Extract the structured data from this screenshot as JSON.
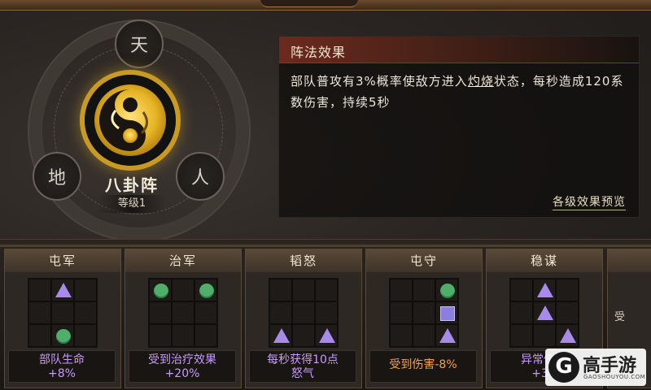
{
  "formation": {
    "name": "八卦阵",
    "level": "等级1",
    "nodes": [
      "天",
      "地",
      "人"
    ]
  },
  "effect": {
    "title": "阵法效果",
    "desc_before": "部队普攻有3%概率使敌方进入",
    "desc_highlight": "灼烧",
    "desc_after": "状态，每秒造成120系数伤害，持续5秒",
    "preview_link": "各级效果预览"
  },
  "cards": [
    {
      "title": "屯军",
      "bonus_line1": "部队生命",
      "bonus_line2": "+8%",
      "color": "purple",
      "cells": [
        "",
        "triangle",
        "",
        "",
        "",
        "",
        "",
        "circle",
        ""
      ]
    },
    {
      "title": "治军",
      "bonus_line1": "受到治疗效果",
      "bonus_line2": "+20%",
      "color": "purple",
      "cells": [
        "circle",
        "",
        "circle",
        "",
        "",
        "",
        "",
        "",
        ""
      ]
    },
    {
      "title": "韬怒",
      "bonus_line1": "每秒获得10点",
      "bonus_line2": "怒气",
      "color": "purple",
      "cells": [
        "",
        "",
        "",
        "",
        "",
        "",
        "triangle",
        "",
        "triangle"
      ]
    },
    {
      "title": "屯守",
      "bonus_line1": "受到伤害-8%",
      "bonus_line2": "",
      "color": "orange",
      "cells": [
        "",
        "",
        "circle",
        "",
        "",
        "square",
        "",
        "",
        "triangle"
      ]
    },
    {
      "title": "稳谋",
      "bonus_line1": "异常伤害",
      "bonus_line2": "+30",
      "color": "purple",
      "cells": [
        "",
        "triangle",
        "",
        "",
        "triangle",
        "",
        "",
        "",
        "triangle"
      ]
    }
  ],
  "partial_card": {
    "text": "受"
  },
  "watermark": {
    "logo": "G",
    "name": "高手游",
    "site": "GAOSHOUYOU.COM"
  },
  "colors": {
    "circle": "#4fae6a",
    "triangle": "#a88ae8",
    "square": "#8a7ee0",
    "purple_text": "#c89aff",
    "orange_text": "#f0a34a",
    "header_red": "#6b2a1e"
  }
}
